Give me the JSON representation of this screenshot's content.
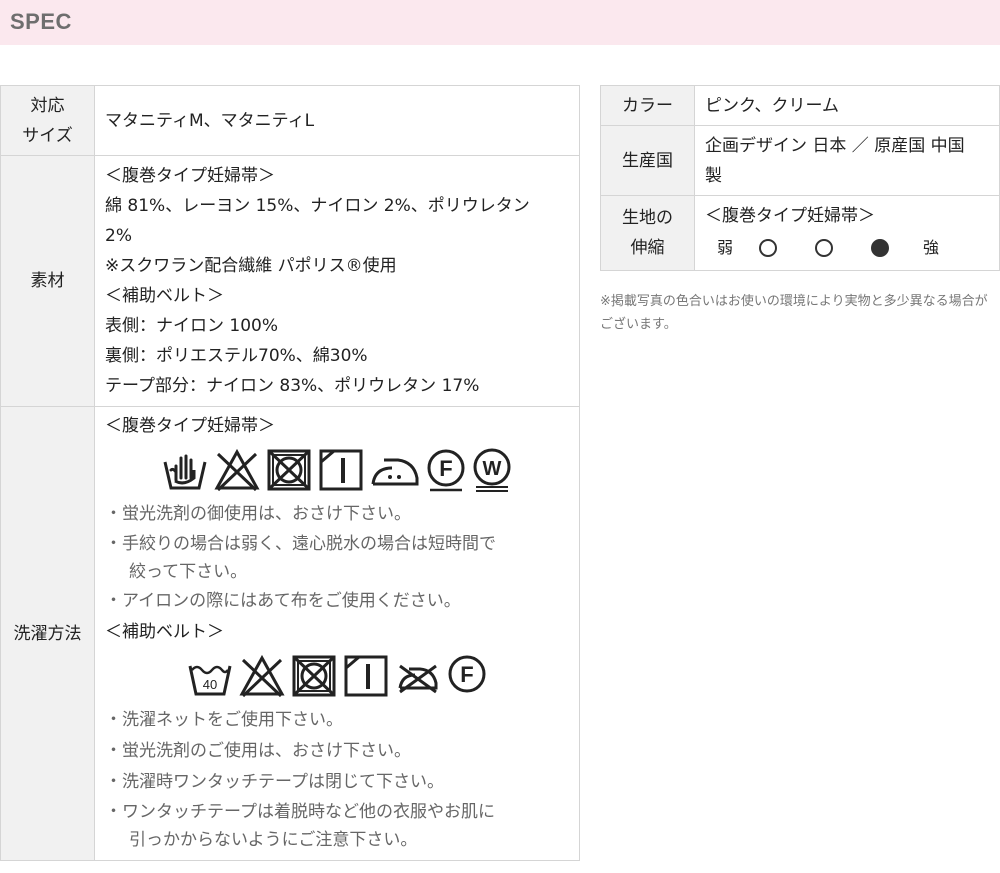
{
  "header": {
    "title": "SPEC"
  },
  "left_table": {
    "size": {
      "label_lines": [
        "対応",
        "サイズ"
      ],
      "value": "マタニティM、マタニティL"
    },
    "material": {
      "label": "素材",
      "lines": [
        "＜腹巻タイプ妊婦帯＞",
        "綿 81%、レーヨン 15%、ナイロン 2%、ポリウレタン",
        "2%",
        "※スクワラン配合繊維 パポリス®使用",
        "＜補助ベルト＞",
        "表側：ナイロン 100%",
        "裏側：ポリエステル70%、綿30%",
        "テープ部分：ナイロン 83%、ポリウレタン 17%"
      ]
    },
    "washing": {
      "label": "洗濯方法",
      "section1_title": "＜腹巻タイプ妊婦帯＞",
      "icons1": [
        "hand-wash-icon",
        "no-bleach-icon",
        "no-tumble-dry-icon",
        "line-dry-shade-icon",
        "iron-low-icon",
        "dry-clean-f-icon",
        "wet-clean-w-icon"
      ],
      "icons1_text": {
        "f": "F",
        "w": "W"
      },
      "notes1": [
        "・蛍光洗剤の御使用は、おさけ下さい。",
        "・手絞りの場合は弱く、遠心脱水の場合は短時間で",
        "絞って下さい。",
        "・アイロンの際にはあて布をご使用ください。"
      ],
      "section2_title": "＜補助ベルト＞",
      "icons2": [
        "machine-wash-40-icon",
        "no-bleach-icon",
        "no-tumble-dry-icon",
        "line-dry-shade-icon",
        "no-iron-icon",
        "dry-clean-f-icon"
      ],
      "icons2_text": {
        "temp": "40",
        "f": "F"
      },
      "notes2": [
        "・洗濯ネットをご使用下さい。",
        "・蛍光洗剤のご使用は、おさけ下さい。",
        "・洗濯時ワンタッチテープは閉じて下さい。",
        "・ワンタッチテープは着脱時など他の衣服やお肌に",
        "引っかからないようにご注意下さい。"
      ]
    }
  },
  "right_table": {
    "color": {
      "label": "カラー",
      "value": "ピンク、クリーム"
    },
    "origin": {
      "label": "生産国",
      "lines": [
        "企画デザイン 日本 ／ 原産国 中国",
        "製"
      ]
    },
    "stretch": {
      "label_lines": [
        "生地の",
        "伸縮"
      ],
      "title": "＜腹巻タイプ妊婦帯＞",
      "low": "弱",
      "high": "強",
      "levels": 3,
      "selected": 3
    }
  },
  "note": "※掲載写真の色合いはお使いの環境により実物と多少異なる場合がございます。",
  "colors": {
    "header_bg": "#fbe8ee",
    "label_bg": "#f1f1f1",
    "border": "#d5d5d5"
  }
}
